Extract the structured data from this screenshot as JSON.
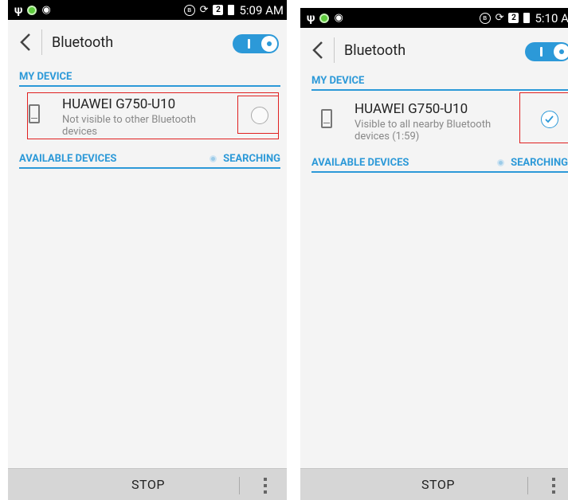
{
  "screens": [
    {
      "status": {
        "time": "5:09 AM"
      },
      "title": "Bluetooth",
      "my_device_header": "MY DEVICE",
      "device": {
        "name": "HUAWEI G750-U10",
        "status": "Not visible to other Bluetooth devices",
        "visible_checked": false
      },
      "available_header": "AVAILABLE DEVICES",
      "searching": "SEARCHING",
      "stop_label": "STOP"
    },
    {
      "status": {
        "time": "5:10 AM"
      },
      "title": "Bluetooth",
      "my_device_header": "MY DEVICE",
      "device": {
        "name": "HUAWEI G750-U10",
        "status": "Visible to all nearby Bluetooth devices (1:59)",
        "visible_checked": true
      },
      "available_header": "AVAILABLE DEVICES",
      "searching": "SEARCHING",
      "stop_label": "STOP"
    }
  ],
  "colors": {
    "accent": "#2c99d8",
    "highlight_box": "#e02020",
    "bottom_bar": "#d6d6d6"
  },
  "icons": [
    "usb-icon",
    "sync-icon",
    "android-icon",
    "bluetooth-icon",
    "rotate-icon",
    "sim-icon",
    "battery-icon",
    "back-icon",
    "phone-icon",
    "overflow-menu-icon"
  ]
}
